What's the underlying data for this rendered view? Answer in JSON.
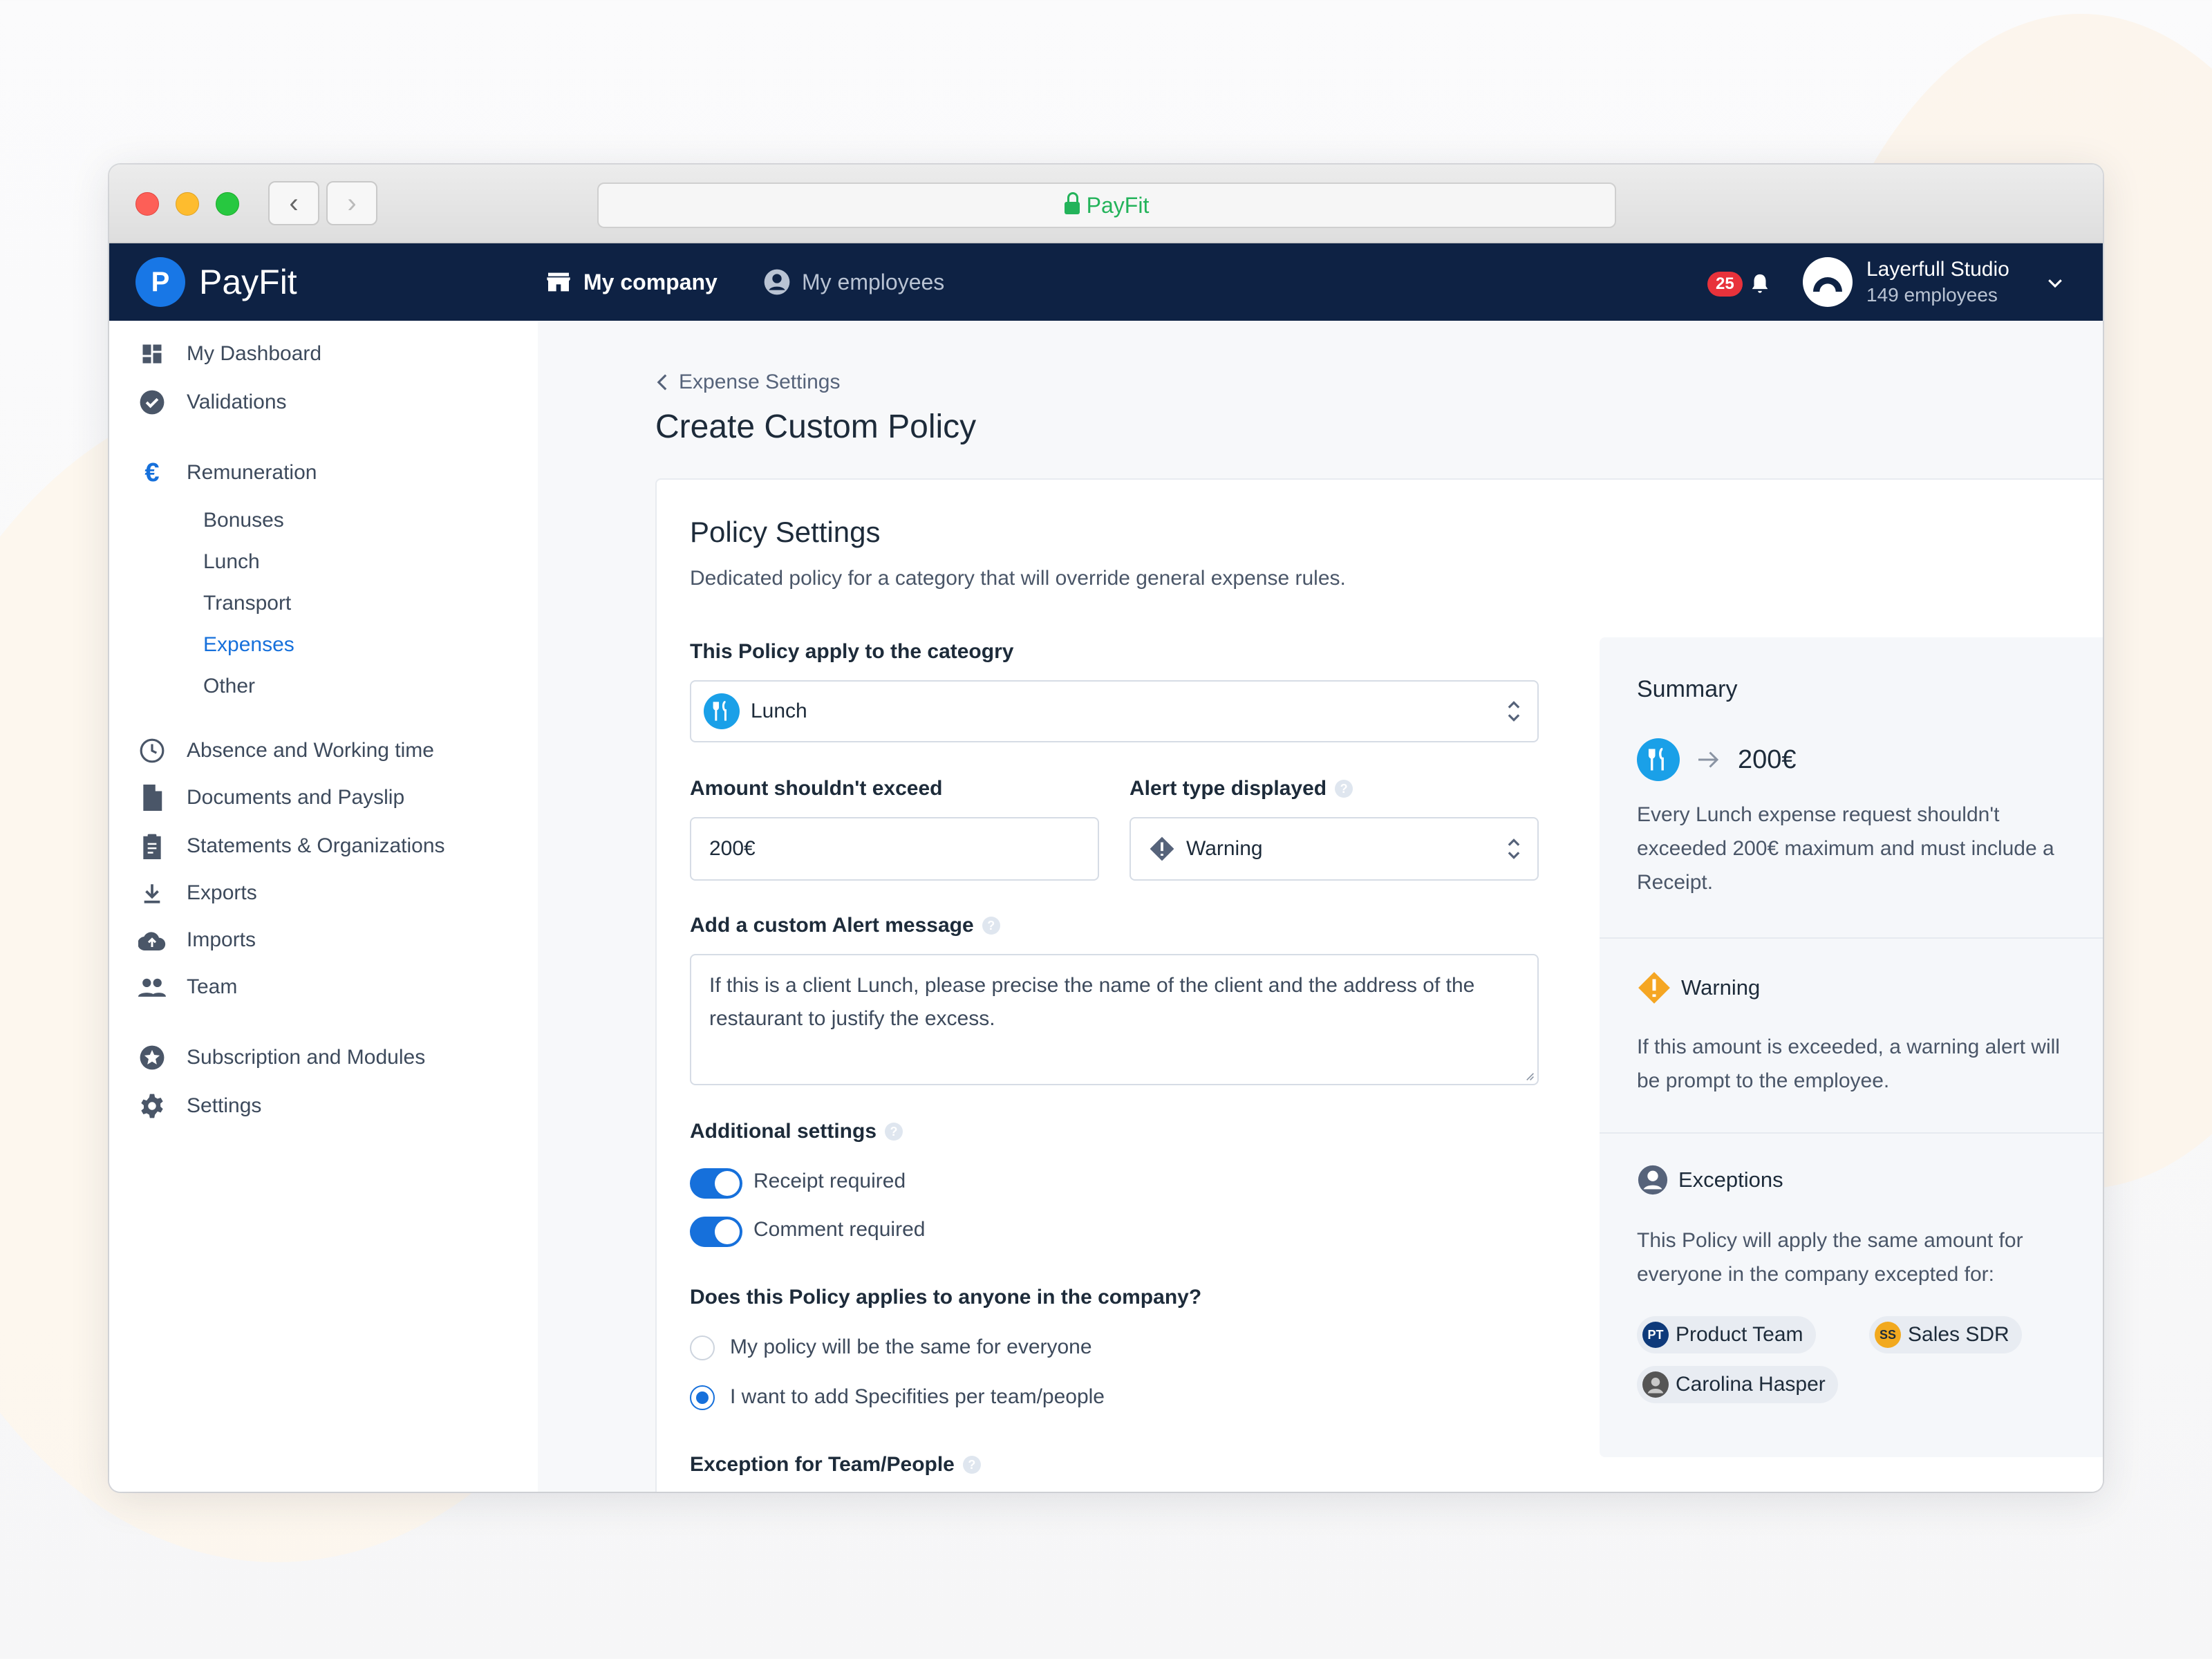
{
  "browser": {
    "address": "PayFit",
    "back_icon": "chevron-left-icon",
    "forward_icon": "chevron-right-icon"
  },
  "appbar": {
    "brand": "PayFit",
    "nav": [
      {
        "label": "My company",
        "icon": "store-icon"
      },
      {
        "label": "My employees",
        "icon": "user-circle-icon"
      }
    ],
    "notifications": "25",
    "account": {
      "name": "Layerfull Studio",
      "sub": "149 employees"
    }
  },
  "sidebar": {
    "items": [
      {
        "label": "My Dashboard",
        "icon": "dashboard-icon"
      },
      {
        "label": "Validations",
        "icon": "check-circle-icon"
      },
      {
        "label": "Remuneration",
        "icon": "euro-icon"
      },
      {
        "label": "Absence and Working time",
        "icon": "clock-icon"
      },
      {
        "label": "Documents and Payslip",
        "icon": "document-icon"
      },
      {
        "label": "Statements & Organizations",
        "icon": "clipboard-icon"
      },
      {
        "label": "Exports",
        "icon": "download-icon"
      },
      {
        "label": "Imports",
        "icon": "cloud-upload-icon"
      },
      {
        "label": "Team",
        "icon": "people-icon"
      },
      {
        "label": "Subscription and Modules",
        "icon": "star-icon"
      },
      {
        "label": "Settings",
        "icon": "gear-icon"
      }
    ],
    "sub": [
      "Bonuses",
      "Lunch",
      "Transport",
      "Expenses",
      "Other"
    ],
    "active_sub": "Expenses"
  },
  "page": {
    "breadcrumb": "Expense Settings",
    "title": "Create Custom Policy"
  },
  "form": {
    "title": "Policy Settings",
    "description": "Dedicated policy for a category that will override general expense rules.",
    "category_label": "This Policy apply to the cateogry",
    "category_value": "Lunch",
    "amount_label": "Amount shouldn't exceed",
    "amount_value": "200€",
    "alert_label": "Alert type displayed",
    "alert_value": "Warning",
    "message_label": "Add a custom Alert message",
    "message_value": "If this is a client Lunch, please precise the name of the client and the address of the restaurant to justify the excess.",
    "additional_label": "Additional settings",
    "toggles": [
      {
        "label": "Receipt required",
        "on": true
      },
      {
        "label": "Comment required",
        "on": true
      }
    ],
    "scope_label": "Does this Policy applies to anyone in the company?",
    "radios": [
      {
        "label": "My policy will be the same for everyone",
        "checked": false
      },
      {
        "label": "I want to add Specifities per team/people",
        "checked": true
      }
    ],
    "exception_label": "Exception for Team/People"
  },
  "summary": {
    "title": "Summary",
    "amount": "200€",
    "text": "Every Lunch expense request shouldn't exceeded 200€ maximum and must include a Receipt.",
    "warning_title": "Warning",
    "warning_text": "If this amount is exceeded, a warning alert will be prompt to the employee.",
    "exceptions_title": "Exceptions",
    "exceptions_text": "This Policy will apply the same amount for everyone in the company excepted for:",
    "chips": [
      {
        "initials": "PT",
        "label": "Product Team",
        "color": "#0e3a7a"
      },
      {
        "initials": "SS",
        "label": "Sales SDR",
        "color": "#f2a91e"
      },
      {
        "initials": "",
        "label": "Carolina Hasper",
        "color": "#555555"
      }
    ]
  },
  "colors": {
    "navy": "#0e2244",
    "accent": "#1670db",
    "warning": "#f5a623"
  }
}
